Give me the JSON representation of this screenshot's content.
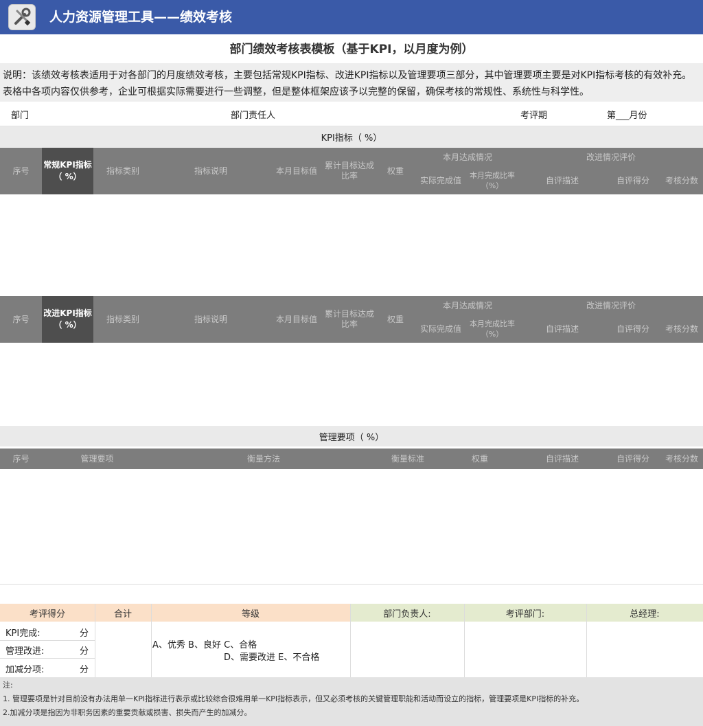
{
  "app": {
    "title": "人力资源管理工具——绩效考核",
    "icon": "wrench-screwdriver-icon"
  },
  "document": {
    "title": "部门绩效考核表模板（基于KPI，以月度为例）",
    "description": "说明：该绩效考核表适用于对各部门的月度绩效考核，主要包括常规KPI指标、改进KPI指标以及管理要项三部分，其中管理要项主要是对KPI指标考核的有效补充。表格中各项内容仅供参考，企业可根据实际需要进行一些调整，但是整体框架应该予以完整的保留，确保考核的常规性、系统性与科学性。"
  },
  "dept_row": {
    "dept_label": "部门",
    "leader_label": "部门责任人",
    "period_label": "考评期",
    "month_label": "第___月份"
  },
  "kpi_section": {
    "title": "KPI指标（        %）"
  },
  "regular_kpi_header": {
    "seq": "序号",
    "category": "常规KPI指标（ %）",
    "indicator_type": "指标类别",
    "indicator_desc": "指标说明",
    "month_target": "本月目标值",
    "cumulative": "累计目标达成比率",
    "weight": "权重",
    "completion_group": "本月达成情况",
    "actual": "实际完成值",
    "rate": "本月完成比率（%）",
    "eval_group": "改进情况评价",
    "eval_desc": "自评描述",
    "self_score": "自评得分",
    "final_score": "考核分数"
  },
  "improve_kpi_header": {
    "seq": "序号",
    "category": "改进KPI指标（ %）",
    "indicator_type": "指标类别",
    "indicator_desc": "指标说明",
    "month_target": "本月目标值",
    "cumulative": "累计目标达成比率",
    "weight": "权重",
    "completion_group": "本月达成情况",
    "actual": "实际完成值",
    "rate": "本月完成比率（%）",
    "eval_group": "改进情况评价",
    "eval_desc": "自评描述",
    "self_score": "自评得分",
    "final_score": "考核分数"
  },
  "mgmt_section": {
    "title": "管理要项（        %）"
  },
  "mgmt_header": {
    "seq": "序号",
    "item": "管理要项",
    "method": "衡量方法",
    "standard": "衡量标准",
    "weight": "权重",
    "eval_desc": "自评描述",
    "self_score": "自评得分",
    "final_score": "考核分数"
  },
  "summary": {
    "score_label": "考评得分",
    "total_label": "合计",
    "grade_label": "等级",
    "dept_leader_label": "部门负责人:",
    "eval_dept_label": "考评部门:",
    "gm_label": "总经理:",
    "kpi_done": "KPI完成:",
    "mgmt_improve": "管理改进:",
    "bonus": "加减分项:",
    "unit": "分",
    "grades_line1": "A、优秀  B、良好  C、合格",
    "grades_line2": "D、需要改进  E、不合格"
  },
  "notes": {
    "title": "注:",
    "note1": "1. 管理要项是针对目前没有办法用单一KPI指标进行表示或比较综合很难用单一KPI指标表示，但又必须考核的关键管理职能和活动而设立的指标，管理要项是KPI指标的补充。",
    "note2": "2.加减分项是指因为非职务因素的重要贡献或损害、损失而产生的加减分。"
  },
  "colors": {
    "title_bar": "#3a5aa8",
    "header_gray": "#7d7d7d",
    "header_dark": "#4e4e4e",
    "summary_peach": "#fbe0c8",
    "summary_green": "#e4ebcf"
  }
}
